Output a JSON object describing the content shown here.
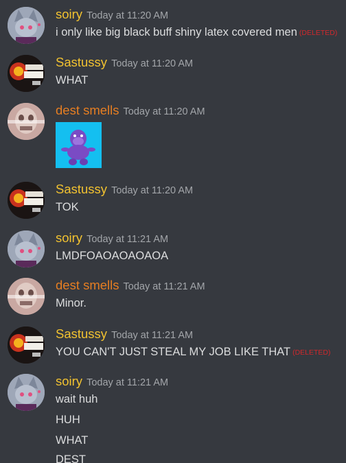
{
  "colors": {
    "background": "#36393f",
    "username_yellow": "#f2c230",
    "username_orange": "#e67e22",
    "timestamp": "#a3a6aa",
    "message_text": "#dcddde",
    "deleted_red": "#d0282c"
  },
  "deleted_label": "(DELETED)",
  "messages": [
    {
      "username": "soiry",
      "timestamp": "Today at 11:20 AM",
      "lines": [
        "i only like big black buff shiny latex covered men"
      ]
    },
    {
      "username": "Sastussy",
      "timestamp": "Today at 11:20 AM",
      "lines": [
        "WHAT"
      ]
    },
    {
      "username": "dest smells",
      "timestamp": "Today at 11:20 AM",
      "lines": []
    },
    {
      "username": "Sastussy",
      "timestamp": "Today at 11:20 AM",
      "lines": [
        "TOK"
      ]
    },
    {
      "username": "soiry",
      "timestamp": "Today at 11:21 AM",
      "lines": [
        "LMDFOAOAOAOAOA"
      ]
    },
    {
      "username": "dest smells",
      "timestamp": "Today at 11:21 AM",
      "lines": [
        "Minor."
      ]
    },
    {
      "username": "Sastussy",
      "timestamp": "Today at 11:21 AM",
      "lines": [
        "YOU CAN'T JUST STEAL MY JOB LIKE THAT"
      ]
    },
    {
      "username": "soiry",
      "timestamp": "Today at 11:21 AM",
      "lines": [
        "wait huh",
        "HUH",
        "WHAT",
        "DEST"
      ]
    }
  ]
}
